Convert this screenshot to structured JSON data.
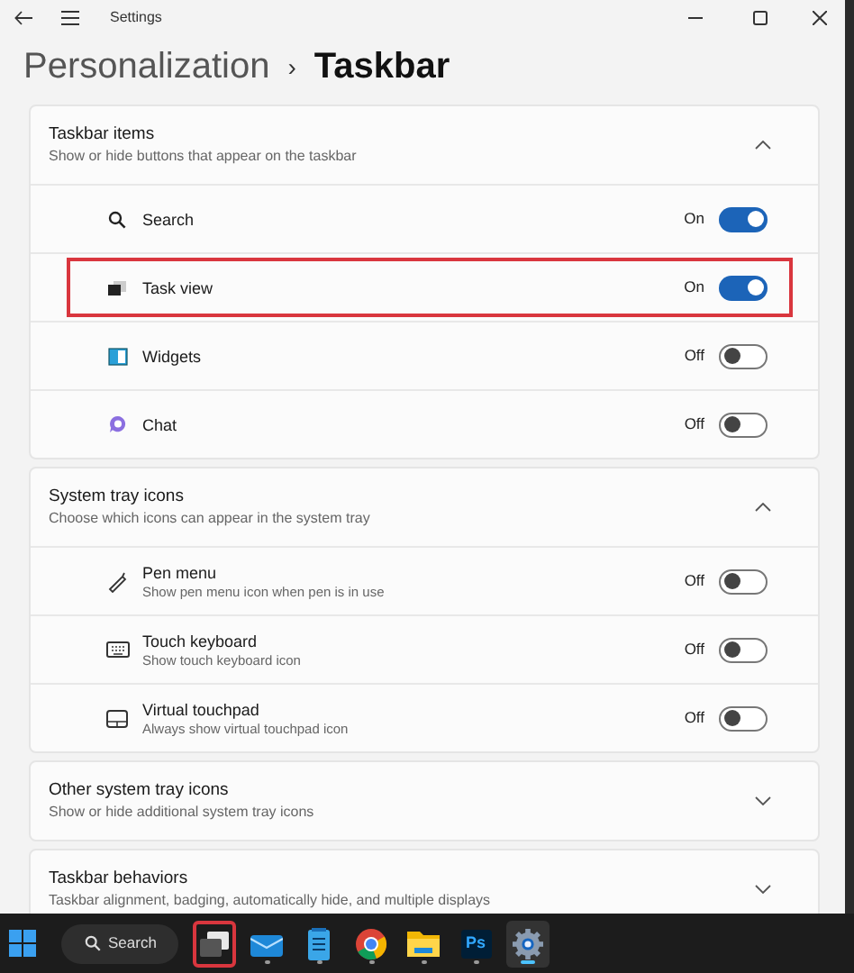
{
  "window": {
    "title": "Settings"
  },
  "breadcrumb": {
    "parent": "Personalization",
    "separator": "›",
    "current": "Taskbar"
  },
  "sections": [
    {
      "title": "Taskbar items",
      "subtitle": "Show or hide buttons that appear on the taskbar",
      "expanded": true,
      "items": [
        {
          "kind": "search",
          "label": "Search",
          "state_text": "On",
          "on": true,
          "highlighted": false
        },
        {
          "kind": "taskview",
          "label": "Task view",
          "state_text": "On",
          "on": true,
          "highlighted": true
        },
        {
          "kind": "widgets",
          "label": "Widgets",
          "state_text": "Off",
          "on": false,
          "highlighted": false
        },
        {
          "kind": "chat",
          "label": "Chat",
          "state_text": "Off",
          "on": false,
          "highlighted": false
        }
      ]
    },
    {
      "title": "System tray icons",
      "subtitle": "Choose which icons can appear in the system tray",
      "expanded": true,
      "items": [
        {
          "kind": "pen",
          "label": "Pen menu",
          "description": "Show pen menu icon when pen is in use",
          "state_text": "Off",
          "on": false,
          "highlighted": false
        },
        {
          "kind": "keyboard",
          "label": "Touch keyboard",
          "description": "Show touch keyboard icon",
          "state_text": "Off",
          "on": false,
          "highlighted": false
        },
        {
          "kind": "touchpad",
          "label": "Virtual touchpad",
          "description": "Always show virtual touchpad icon",
          "state_text": "Off",
          "on": false,
          "highlighted": false
        }
      ]
    },
    {
      "title": "Other system tray icons",
      "subtitle": "Show or hide additional system tray icons",
      "expanded": false
    },
    {
      "title": "Taskbar behaviors",
      "subtitle": "Taskbar alignment, badging, automatically hide, and multiple displays",
      "expanded": false
    }
  ],
  "taskbar": {
    "search_label": "Search",
    "apps": [
      {
        "kind": "taskview",
        "running": false,
        "active": false,
        "highlighted": true
      },
      {
        "kind": "mail",
        "running": true,
        "active": false,
        "highlighted": false
      },
      {
        "kind": "notepad",
        "running": true,
        "active": false,
        "highlighted": false
      },
      {
        "kind": "chrome",
        "running": true,
        "active": false,
        "highlighted": false
      },
      {
        "kind": "folder",
        "running": true,
        "active": false,
        "highlighted": false
      },
      {
        "kind": "ps",
        "text": "Ps",
        "running": true,
        "active": false,
        "highlighted": false
      },
      {
        "kind": "gear",
        "running": true,
        "active": true,
        "highlighted": false
      }
    ]
  }
}
